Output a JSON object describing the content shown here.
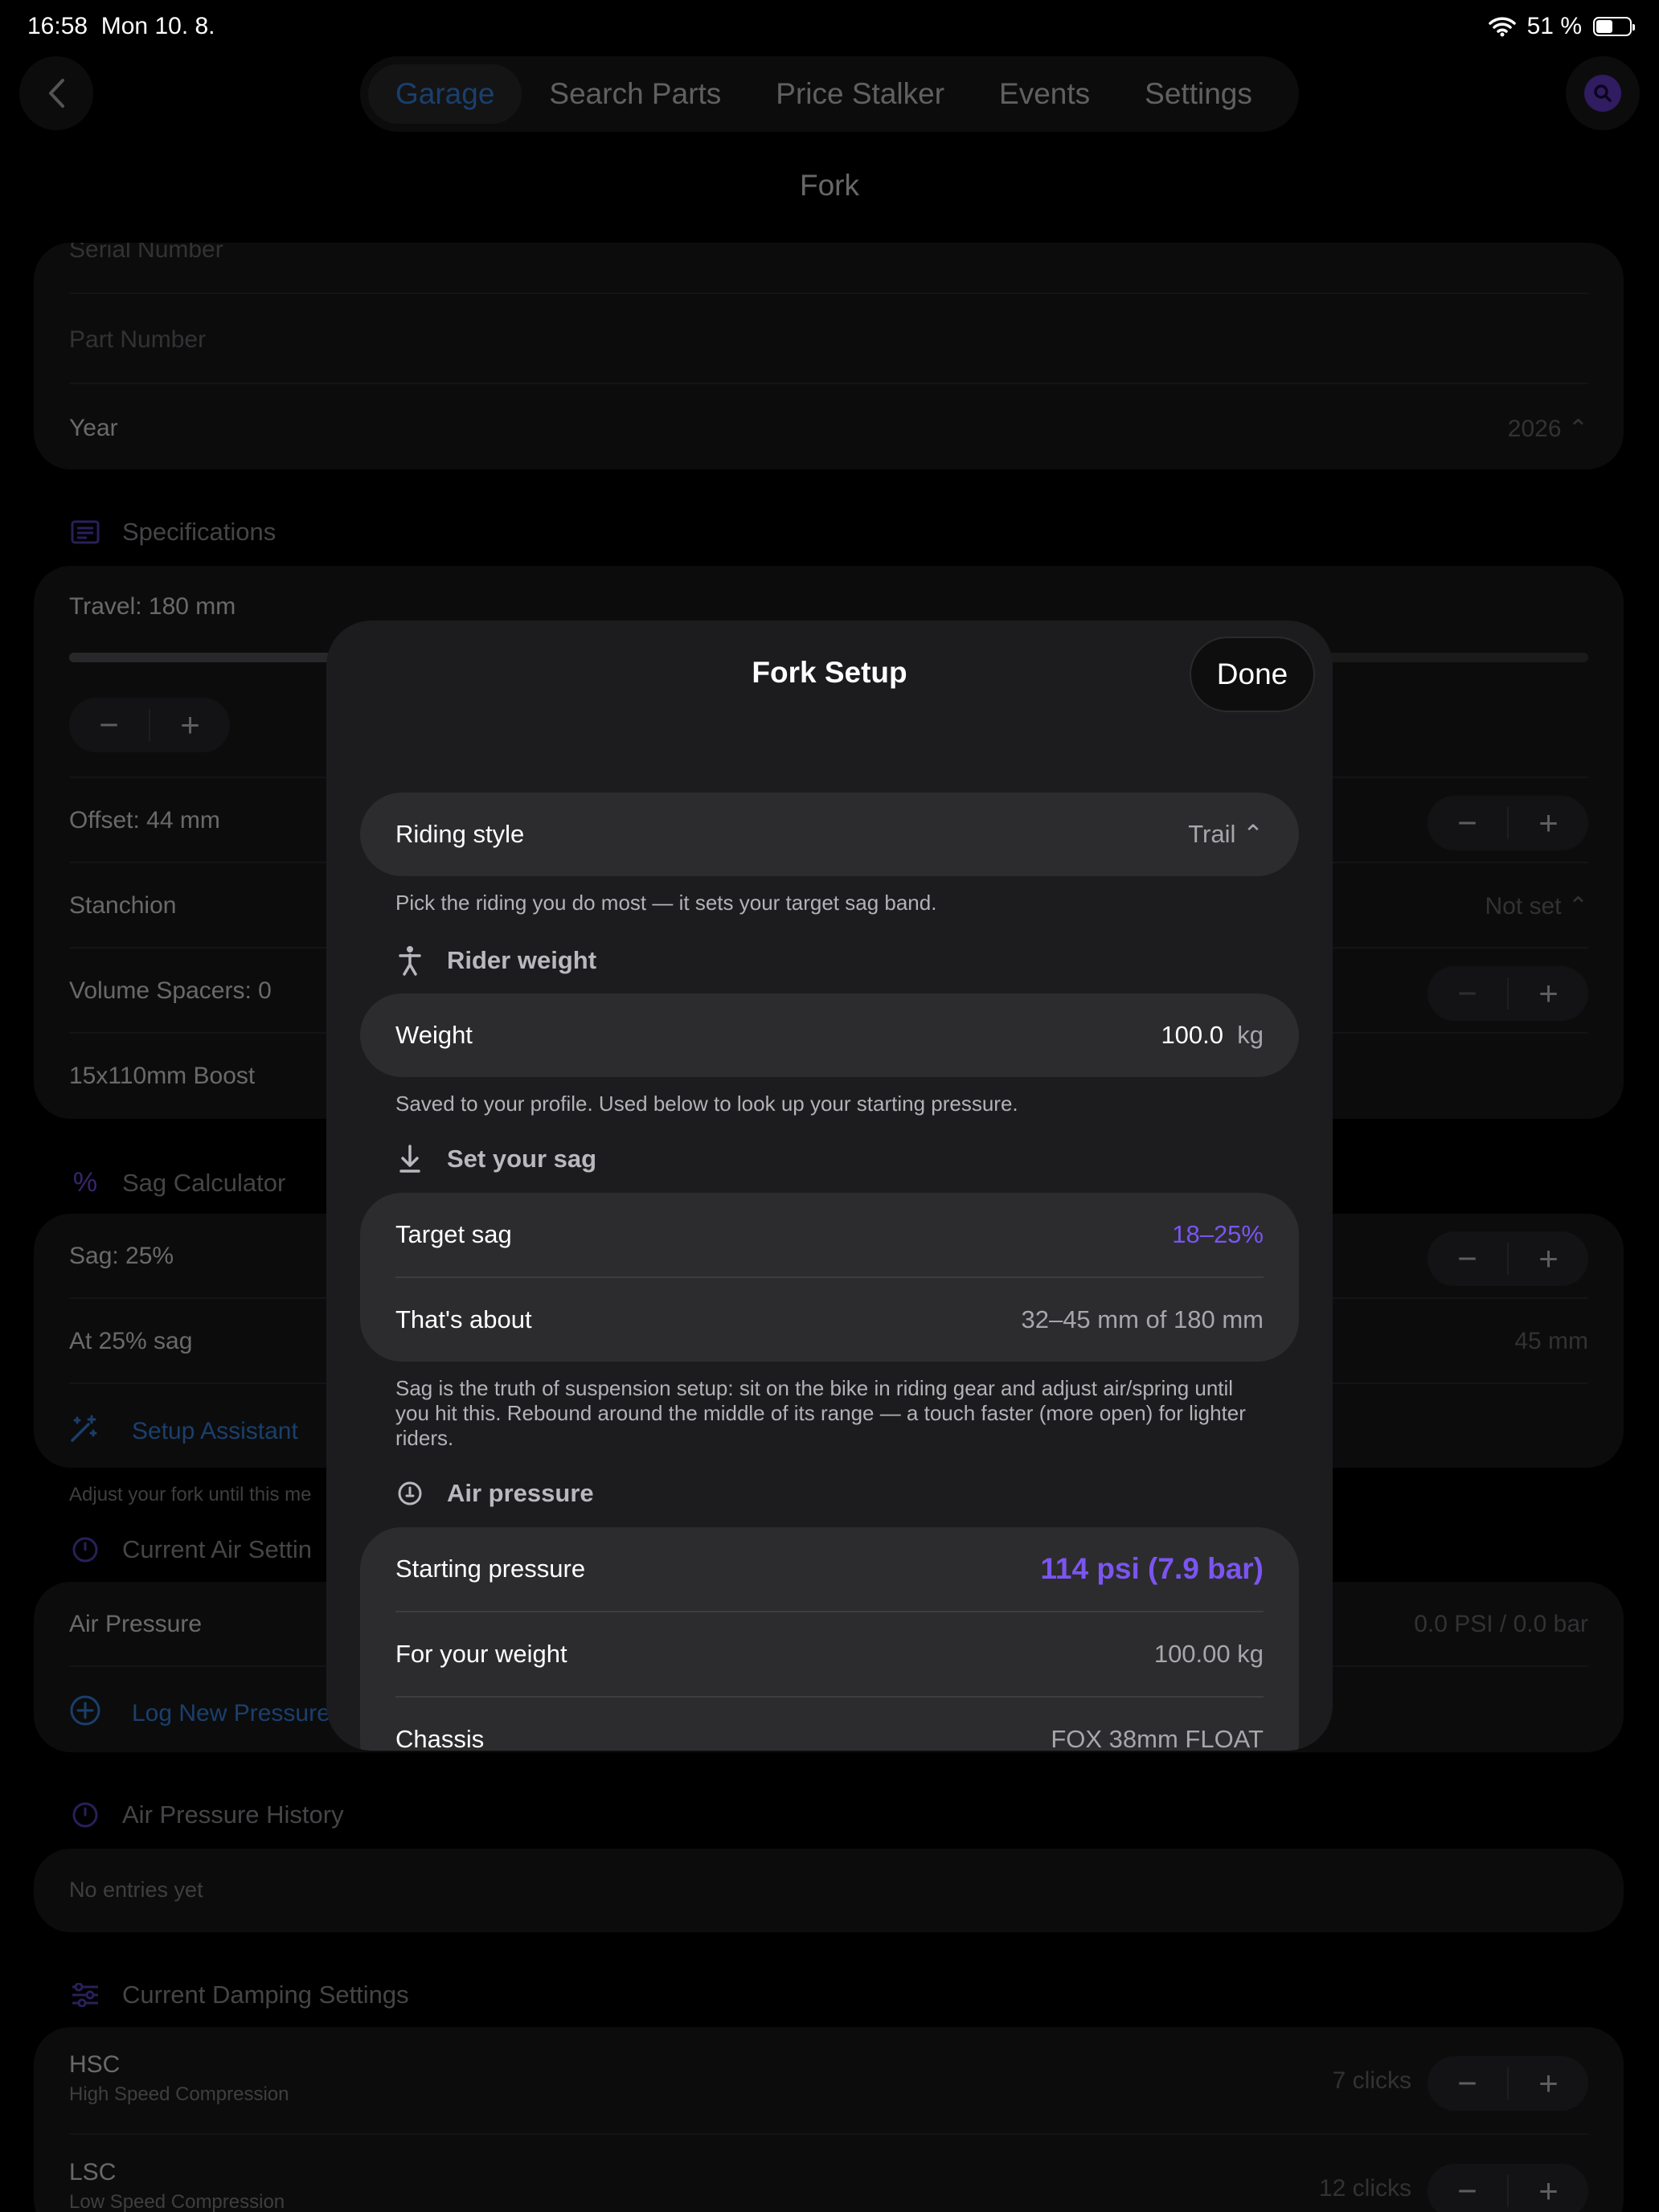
{
  "status_bar": {
    "time": "16:58",
    "date": "Mon 10. 8.",
    "battery": "51 %",
    "battery_level": 0.51
  },
  "nav": {
    "tabs": [
      {
        "label": "Garage",
        "active": true
      },
      {
        "label": "Search Parts"
      },
      {
        "label": "Price Stalker"
      },
      {
        "label": "Events"
      },
      {
        "label": "Settings"
      }
    ],
    "page_title": "Fork"
  },
  "background": {
    "serial_number_placeholder": "Serial Number",
    "part_number_placeholder": "Part Number",
    "year_label": "Year",
    "year_value": "2026",
    "specifications_header": "Specifications",
    "travel_label": "Travel: 180 mm",
    "travel_fraction": 0.55,
    "offset_label": "Offset: 44 mm",
    "stanchion_label": "Stanchion",
    "stanchion_value": "Not set",
    "volume_spacers_label": "Volume Spacers: 0",
    "axle_label": "15x110mm Boost",
    "sag_calculator_header": "Sag Calculator",
    "sag_label": "Sag: 25%",
    "at_sag_label": "At 25% sag",
    "at_sag_value": "45 mm",
    "setup_assistant_label": "Setup Assistant",
    "adjust_note": "Adjust your fork until this me",
    "current_air_header": "Current Air Settin",
    "air_pressure_label": "Air Pressure",
    "air_pressure_value": "0.0 PSI / 0.0 bar",
    "log_new_pressure_label": "Log New Pressure",
    "air_history_header": "Air Pressure History",
    "no_entries": "No entries yet",
    "damping_header": "Current Damping Settings",
    "hsc_label": "HSC",
    "hsc_sub": "High Speed Compression",
    "hsc_value": "7 clicks",
    "lsc_label": "LSC",
    "lsc_sub": "Low Speed Compression",
    "lsc_value": "12 clicks"
  },
  "modal": {
    "title": "Fork Setup",
    "done_label": "Done",
    "riding_style_label": "Riding style",
    "riding_style_value": "Trail",
    "riding_style_note": "Pick the riding you do most — it sets your target sag band.",
    "rider_weight_header": "Rider weight",
    "weight_label": "Weight",
    "weight_value": "100.0",
    "weight_unit": "kg",
    "weight_note": "Saved to your profile. Used below to look up your starting pressure.",
    "set_sag_header": "Set your sag",
    "target_sag_label": "Target sag",
    "target_sag_value": "18–25%",
    "thats_about_label": "That's about",
    "thats_about_value": "32–45 mm of 180 mm",
    "sag_note": "Sag is the truth of suspension setup: sit on the bike in riding gear and adjust air/spring until you hit this. Rebound around the middle of its range — a touch faster (more open) for lighter riders.",
    "air_pressure_header": "Air pressure",
    "starting_pressure_label": "Starting pressure",
    "starting_pressure_value": "114 psi (7.9 bar)",
    "for_weight_label": "For your weight",
    "for_weight_value": "100.00 kg",
    "chassis_label": "Chassis",
    "chassis_value": "FOX 38mm FLOAT"
  },
  "colors": {
    "accent_blue": "#3a8cf0",
    "accent_purple": "#7b55f0",
    "card": "#1c1c1e",
    "modal_card": "#2c2c2e"
  }
}
